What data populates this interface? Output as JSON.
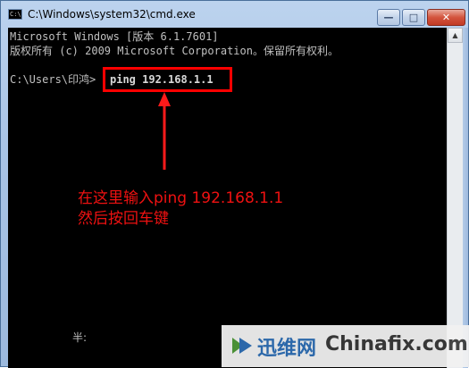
{
  "window": {
    "title": "C:\\Windows\\system32\\cmd.exe",
    "icon_text": "C:\\",
    "buttons": {
      "minimize": "—",
      "maximize": "□",
      "close": "✕"
    }
  },
  "console": {
    "line1": "Microsoft Windows [版本 6.1.7601]",
    "line2": "版权所有 (c) 2009 Microsoft Corporation。保留所有权利。",
    "prompt": "C:\\Users\\印鸿>",
    "command": "ping 192.168.1.1",
    "ime_indicator": "半:"
  },
  "annotation": {
    "line1": "在这里输入ping 192.168.1.1",
    "line2": "然后按回车键",
    "color": "#ee1111"
  },
  "scrollbar": {
    "up_arrow": "▲"
  },
  "watermark": {
    "cn": "迅维网",
    "en": "Chinafix.com"
  }
}
